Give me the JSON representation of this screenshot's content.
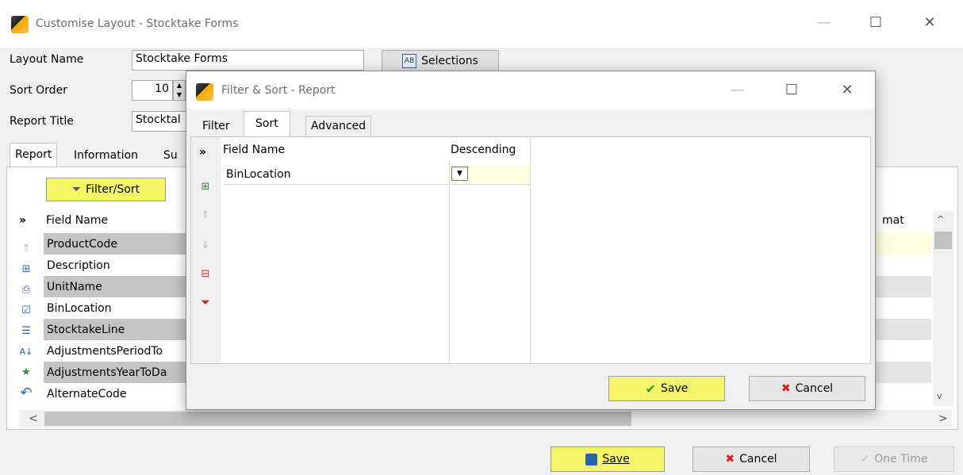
{
  "window": {
    "title": "Customise Layout - Stocktake Forms",
    "min": "—",
    "max": "☐",
    "close": "✕"
  },
  "form": {
    "layout_name_label": "Layout Name",
    "layout_name_value": "Stocktake Forms",
    "sort_order_label": "Sort Order",
    "sort_order_value": "10",
    "report_title_label": "Report Title",
    "report_title_value": "Stocktal",
    "selections_button": "Selections"
  },
  "tabs": [
    "Report",
    "Information",
    "Su"
  ],
  "report_panel": {
    "filter_sort_button": "Filter/Sort",
    "column_header": "Field Name",
    "format_header": "mat",
    "rows": [
      {
        "name": "ProductCode",
        "selected": true
      },
      {
        "name": "Description",
        "selected": false
      },
      {
        "name": "UnitName",
        "selected": true
      },
      {
        "name": "BinLocation",
        "selected": false
      },
      {
        "name": "StocktakeLine",
        "selected": true
      },
      {
        "name": "AdjustmentsPeriodTo",
        "selected": false
      },
      {
        "name": "AdjustmentsYearToDa",
        "selected": true
      },
      {
        "name": "AlternateCode",
        "selected": false
      }
    ],
    "side_icons": [
      "move-up-icon",
      "add-field-icon",
      "print-icon",
      "checklist-icon",
      "list-icon",
      "sort-az-icon",
      "star-icon",
      "undo-icon"
    ]
  },
  "bottom_buttons": {
    "save": "Save",
    "cancel": "Cancel",
    "one_time": "One Time"
  },
  "dialog": {
    "title": "Filter & Sort - Report",
    "tabs": [
      "Filter",
      "Sort",
      "Advanced"
    ],
    "active_tab": "Sort",
    "columns": {
      "field_name": "Field Name",
      "descending": "Descending"
    },
    "rows": [
      {
        "field": "BinLocation",
        "descending": ""
      }
    ],
    "save": "Save",
    "cancel": "Cancel"
  },
  "colors": {
    "highlight_yellow": "#f5f56a",
    "selected_row": "#c4c4c4",
    "editing_cell": "#ffffe0"
  }
}
